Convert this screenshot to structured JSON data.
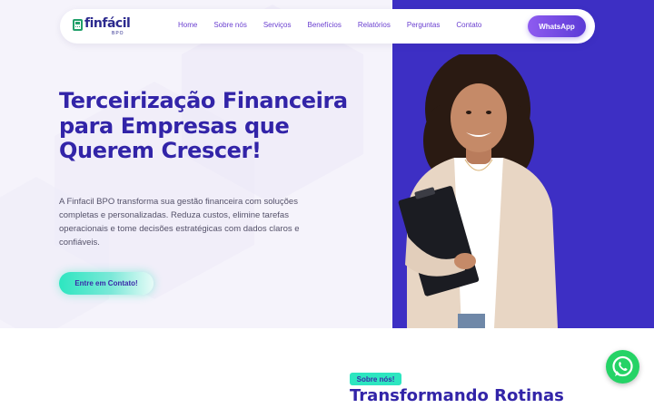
{
  "brand": {
    "name": "finfácil",
    "sub": "BPO",
    "primary_color": "#3224a8",
    "panel_color": "#3d2fc4",
    "accent_color": "#2de6c0",
    "logo_green": "#21a06a"
  },
  "nav": {
    "items": [
      {
        "label": "Home"
      },
      {
        "label": "Sobre nós"
      },
      {
        "label": "Serviços"
      },
      {
        "label": "Benefícios"
      },
      {
        "label": "Relatórios"
      },
      {
        "label": "Perguntas"
      },
      {
        "label": "Contato"
      }
    ],
    "whatsapp_label": "WhatsApp"
  },
  "hero": {
    "title": "Terceirização Financeira para Empresas que Querem Crescer!",
    "description": "A Finfacil BPO transforma sua gestão financeira com soluções completas e personalizadas. Reduza custos, elimine tarefas operacionais e tome decisões estratégicas com dados claros e confiáveis.",
    "cta_label": "Entre em Contato!"
  },
  "about": {
    "badge": "Sobre nós!",
    "title": "Transformando Rotinas"
  },
  "icons": {
    "floating": "whatsapp-icon",
    "logo": "calculator-icon"
  }
}
